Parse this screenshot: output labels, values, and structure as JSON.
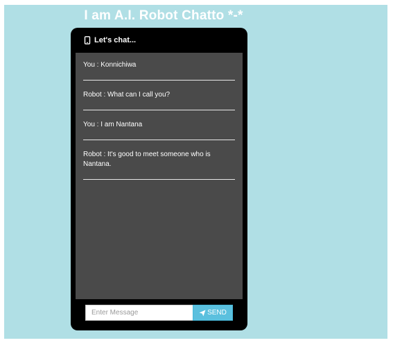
{
  "page": {
    "title": "I am A.I. Robot Chatto *-*"
  },
  "chat": {
    "header_label": "Let's chat...",
    "header_icon": "mobile-phone-icon",
    "messages": [
      {
        "text": "You : Konnichiwa"
      },
      {
        "text": "Robot : What can I call you?"
      },
      {
        "text": "You : I am Nantana"
      },
      {
        "text": "Robot : It's good to meet someone who is Nantana."
      }
    ]
  },
  "input": {
    "placeholder": "Enter Message",
    "value": ""
  },
  "send": {
    "label": "SEND",
    "icon": "paper-plane-icon",
    "color": "#5bc0de"
  },
  "colors": {
    "background": "#b0dfe5",
    "phone": "#000000",
    "chat_area": "#4a4a4a"
  }
}
